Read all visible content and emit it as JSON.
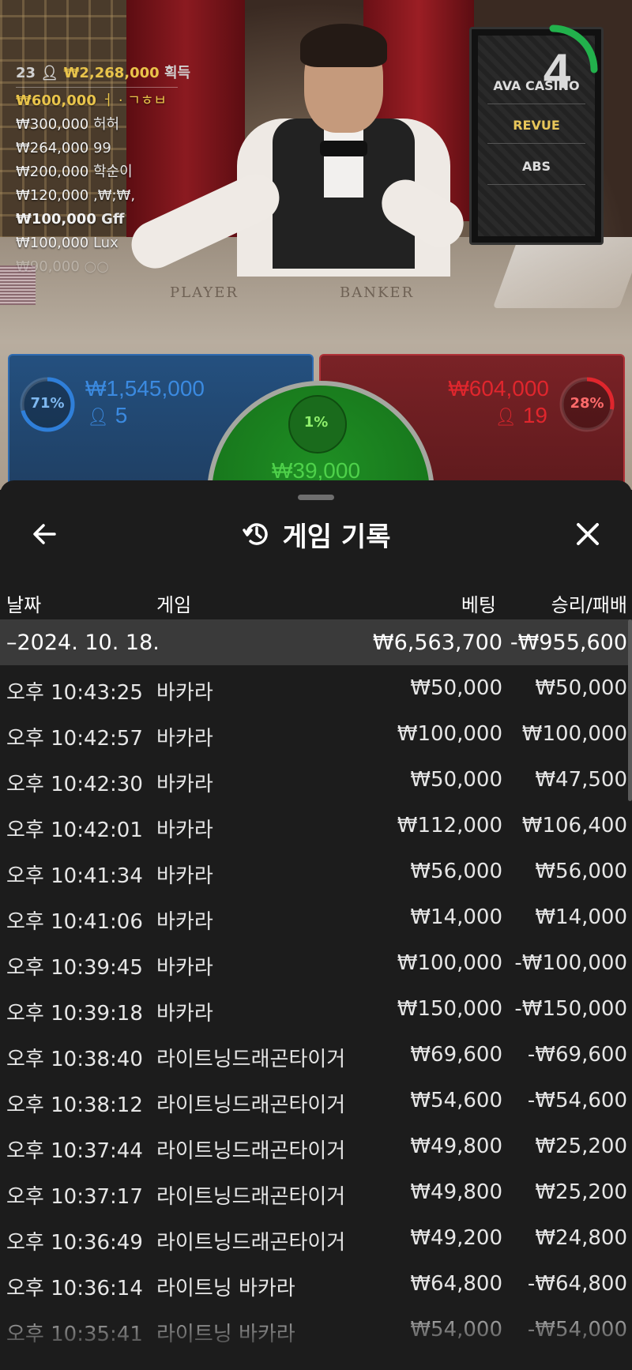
{
  "live": {
    "round_number": "4",
    "sponsors": [
      "AVA CASINO",
      "REVUE",
      "ABS"
    ],
    "felt_player": "PLAYER",
    "felt_banker": "BANKER",
    "winners_summary": {
      "count": "23",
      "amount": "₩2,268,000",
      "suffix": "획득"
    },
    "winners": [
      {
        "amount": "₩600,000",
        "name": "ㅓ · ㄱㅎㅂ"
      },
      {
        "amount": "₩300,000",
        "name": "허허"
      },
      {
        "amount": "₩264,000",
        "name": "99"
      },
      {
        "amount": "₩200,000",
        "name": "학순이"
      },
      {
        "amount": "₩120,000",
        "name": ",₩;₩,"
      },
      {
        "amount": "₩100,000",
        "name": "Gff"
      },
      {
        "amount": "₩100,000",
        "name": "Lux"
      },
      {
        "amount": "₩90,000",
        "name": "○○"
      }
    ],
    "player_bet": {
      "percent": "71%",
      "percent_value": 0.71,
      "amount": "₩1,545,000",
      "players": "5",
      "color": "#2f7fd9"
    },
    "banker_bet": {
      "percent": "28%",
      "percent_value": 0.28,
      "amount": "₩604,000",
      "players": "19",
      "color": "#e0262d"
    },
    "tie_bet": {
      "percent": "1%",
      "amount": "₩39,000",
      "color": "#4ed14a"
    }
  },
  "history": {
    "title": "게임 기록",
    "back_icon": "arrow-left-icon",
    "title_icon": "history-icon",
    "close_icon": "close-icon",
    "columns": {
      "date": "날짜",
      "game": "게임",
      "bet": "베팅",
      "result": "승리/패배"
    },
    "date_group": {
      "label": "–2024. 10. 18.",
      "bet_total": "₩6,563,700",
      "result_total": "-₩955,600"
    },
    "rows": [
      {
        "time": "오후 10:43:25",
        "game": "바카라",
        "bet": "₩50,000",
        "result": "₩50,000"
      },
      {
        "time": "오후 10:42:57",
        "game": "바카라",
        "bet": "₩100,000",
        "result": "₩100,000"
      },
      {
        "time": "오후 10:42:30",
        "game": "바카라",
        "bet": "₩50,000",
        "result": "₩47,500"
      },
      {
        "time": "오후 10:42:01",
        "game": "바카라",
        "bet": "₩112,000",
        "result": "₩106,400"
      },
      {
        "time": "오후 10:41:34",
        "game": "바카라",
        "bet": "₩56,000",
        "result": "₩56,000"
      },
      {
        "time": "오후 10:41:06",
        "game": "바카라",
        "bet": "₩14,000",
        "result": "₩14,000"
      },
      {
        "time": "오후 10:39:45",
        "game": "바카라",
        "bet": "₩100,000",
        "result": "-₩100,000"
      },
      {
        "time": "오후 10:39:18",
        "game": "바카라",
        "bet": "₩150,000",
        "result": "-₩150,000"
      },
      {
        "time": "오후 10:38:40",
        "game": "라이트닝드래곤타이거",
        "bet": "₩69,600",
        "result": "-₩69,600"
      },
      {
        "time": "오후 10:38:12",
        "game": "라이트닝드래곤타이거",
        "bet": "₩54,600",
        "result": "-₩54,600"
      },
      {
        "time": "오후 10:37:44",
        "game": "라이트닝드래곤타이거",
        "bet": "₩49,800",
        "result": "₩25,200"
      },
      {
        "time": "오후 10:37:17",
        "game": "라이트닝드래곤타이거",
        "bet": "₩49,800",
        "result": "₩25,200"
      },
      {
        "time": "오후 10:36:49",
        "game": "라이트닝드래곤타이거",
        "bet": "₩49,200",
        "result": "₩24,800"
      },
      {
        "time": "오후 10:36:14",
        "game": "라이트닝 바카라",
        "bet": "₩64,800",
        "result": "-₩64,800"
      },
      {
        "time": "오후 10:35:41",
        "game": "라이트닝 바카라",
        "bet": "₩54,000",
        "result": "-₩54,000"
      }
    ]
  }
}
